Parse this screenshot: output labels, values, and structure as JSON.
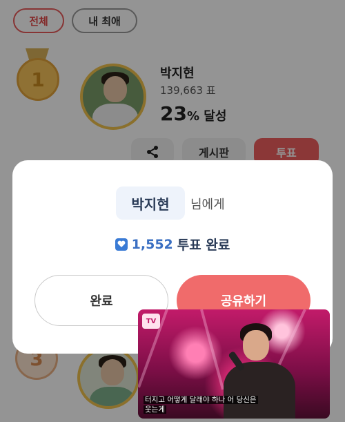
{
  "filter_chips": {
    "all": "전체",
    "mine": "내 최애"
  },
  "rank1": {
    "rank": "1",
    "name": "박지현",
    "votes": "139,663 표",
    "percent_value": "23",
    "percent_unit": "% 달성",
    "actions": {
      "board": "게시판",
      "vote": "투표"
    }
  },
  "rank3": {
    "rank": "3"
  },
  "modal": {
    "recipient": "박지현",
    "recipient_suffix": "님에게",
    "vote_count": "1,552",
    "vote_done": "투표 완료",
    "done_button": "완료",
    "share_button": "공유하기"
  },
  "video": {
    "caption_line1": "터지고 어떻게 달래야 하나 어 당신은",
    "caption_line2": "웃는게"
  },
  "colors": {
    "accent": "#f06b6b",
    "blue": "#3a6fc2",
    "gold": "#f0c24c"
  }
}
